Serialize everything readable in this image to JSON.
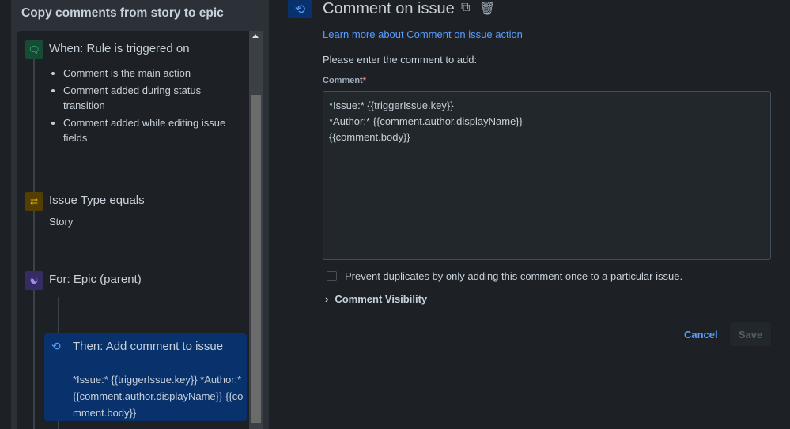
{
  "rule": {
    "title": "Copy comments from story to epic"
  },
  "nodes": {
    "trigger": {
      "title": "When: Rule is triggered on",
      "items": [
        "Comment is the main action",
        "Comment added during status transition",
        "Comment added while editing issue fields"
      ],
      "color": "#1f845a"
    },
    "condition": {
      "title": "Issue Type equals",
      "value": "Story"
    },
    "branch": {
      "title": "For: Epic (parent)"
    },
    "action": {
      "title": "Then: Add comment to issue",
      "detail": "*Issue:* {{triggerIssue.key}} *Author:* {{comment.author.displayName}} {{comment.body}}"
    }
  },
  "editor": {
    "title": "Comment on issue",
    "learn_more": "Learn more about Comment on issue action",
    "prompt": "Please enter the comment to add:",
    "comment_label": "Comment",
    "required_mark": "*",
    "comment_value": "*Issue:* {{triggerIssue.key}}\n*Author:* {{comment.author.displayName}}\n{{comment.body}}",
    "prevent_duplicates": "Prevent duplicates by only adding this comment once to a particular issue.",
    "prevent_duplicates_checked": false,
    "visibility": "Comment Visibility",
    "cancel": "Cancel",
    "save": "Save"
  }
}
